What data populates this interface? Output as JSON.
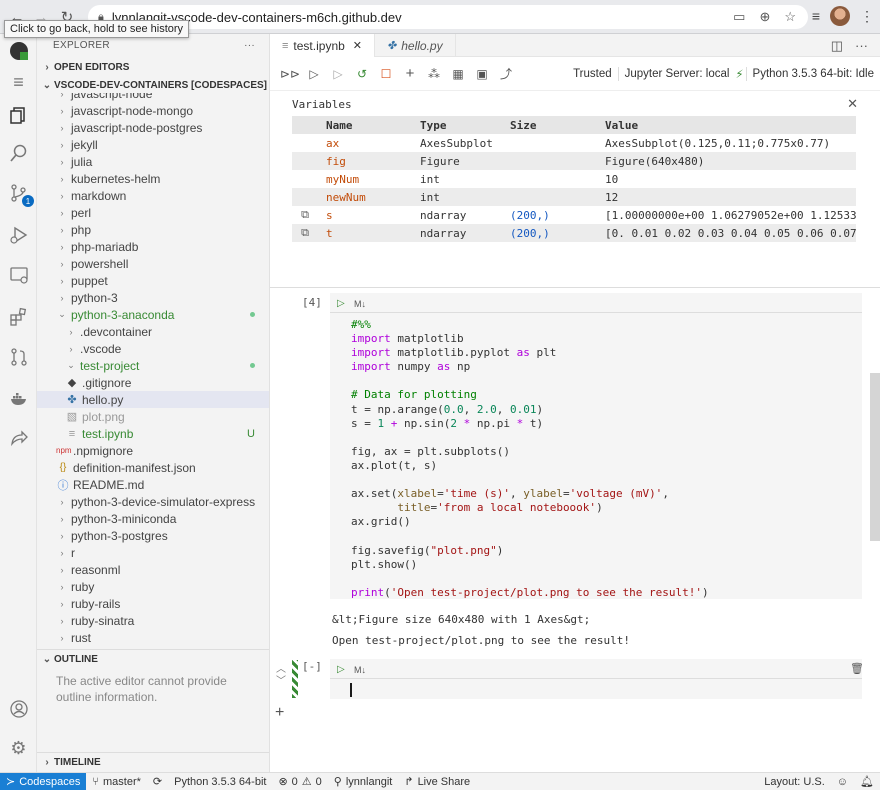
{
  "browser": {
    "url": "lynnlangit-vscode-dev-containers-m6ch.github.dev",
    "tooltip": "Click to go back, hold to see history"
  },
  "sidebar": {
    "explorer_title": "EXPLORER",
    "more": "···",
    "open_editors": "OPEN EDITORS",
    "workspace": "VSCODE-DEV-CONTAINERS [CODESPACES]",
    "items": [
      {
        "label": "javascript-node",
        "kind": "folder"
      },
      {
        "label": "javascript-node-mongo",
        "kind": "folder"
      },
      {
        "label": "javascript-node-postgres",
        "kind": "folder"
      },
      {
        "label": "jekyll",
        "kind": "folder"
      },
      {
        "label": "julia",
        "kind": "folder"
      },
      {
        "label": "kubernetes-helm",
        "kind": "folder"
      },
      {
        "label": "markdown",
        "kind": "folder"
      },
      {
        "label": "perl",
        "kind": "folder"
      },
      {
        "label": "php",
        "kind": "folder"
      },
      {
        "label": "php-mariadb",
        "kind": "folder"
      },
      {
        "label": "powershell",
        "kind": "folder"
      },
      {
        "label": "puppet",
        "kind": "folder"
      },
      {
        "label": "python-3",
        "kind": "folder"
      },
      {
        "label": "python-3-anaconda",
        "kind": "open-folder"
      },
      {
        "label": ".devcontainer",
        "kind": "folder"
      },
      {
        "label": ".vscode",
        "kind": "folder"
      },
      {
        "label": "test-project",
        "kind": "open-folder"
      },
      {
        "label": ".gitignore",
        "kind": "file"
      },
      {
        "label": "hello.py",
        "kind": "file"
      },
      {
        "label": "plot.png",
        "kind": "file"
      },
      {
        "label": "test.ipynb",
        "kind": "file",
        "status": "U"
      },
      {
        "label": ".npmignore",
        "kind": "file"
      },
      {
        "label": "definition-manifest.json",
        "kind": "file"
      },
      {
        "label": "README.md",
        "kind": "file"
      },
      {
        "label": "python-3-device-simulator-express",
        "kind": "folder"
      },
      {
        "label": "python-3-miniconda",
        "kind": "folder"
      },
      {
        "label": "python-3-postgres",
        "kind": "folder"
      },
      {
        "label": "r",
        "kind": "folder"
      },
      {
        "label": "reasonml",
        "kind": "folder"
      },
      {
        "label": "ruby",
        "kind": "folder"
      },
      {
        "label": "ruby-rails",
        "kind": "folder"
      },
      {
        "label": "ruby-sinatra",
        "kind": "folder"
      },
      {
        "label": "rust",
        "kind": "folder"
      }
    ],
    "outline_title": "OUTLINE",
    "outline_msg": "The active editor cannot provide outline information.",
    "timeline_title": "TIMELINE"
  },
  "tabs": [
    {
      "label": "test.ipynb",
      "active": true
    },
    {
      "label": "hello.py",
      "active": false
    }
  ],
  "toolbar": {
    "trusted": "Trusted",
    "jupyter": "Jupyter Server: local",
    "kernel": "Python 3.5.3 64-bit: Idle"
  },
  "variables": {
    "title": "Variables",
    "headers": [
      "Name",
      "Type",
      "Size",
      "Value"
    ],
    "rows": [
      {
        "name": "ax",
        "type": "AxesSubplot",
        "size": "",
        "value": "AxesSubplot(0.125,0.11;0.775x0.77)"
      },
      {
        "name": "fig",
        "type": "Figure",
        "size": "",
        "value": "Figure(640x480)"
      },
      {
        "name": "myNum",
        "type": "int",
        "size": "",
        "value": "10"
      },
      {
        "name": "newNum",
        "type": "int",
        "size": "",
        "value": "12"
      },
      {
        "name": "s",
        "type": "ndarray",
        "size": "(200,)",
        "value": "[1.00000000e+00 1.06279052e+00 1.125333"
      },
      {
        "name": "t",
        "type": "ndarray",
        "size": "(200,)",
        "value": "[0.  0.01 0.02 0.03 0.04 0.05 0.06 0.07 0"
      }
    ]
  },
  "cell1": {
    "exec_count": "[4]",
    "md_label": "M↓",
    "output1": "&lt;Figure size 640x480 with 1 Axes&gt;",
    "output2": "Open test-project/plot.png to see the result!"
  },
  "cell2": {
    "exec_count": "[-]",
    "md_label": "M↓"
  },
  "statusbar": {
    "remote": "Codespaces",
    "branch": "master*",
    "interpreter": "Python 3.5.3 64-bit",
    "problems": "0",
    "warnings": "0",
    "user": "lynnlangit",
    "liveshare": "Live Share",
    "layout": "Layout: U.S."
  }
}
